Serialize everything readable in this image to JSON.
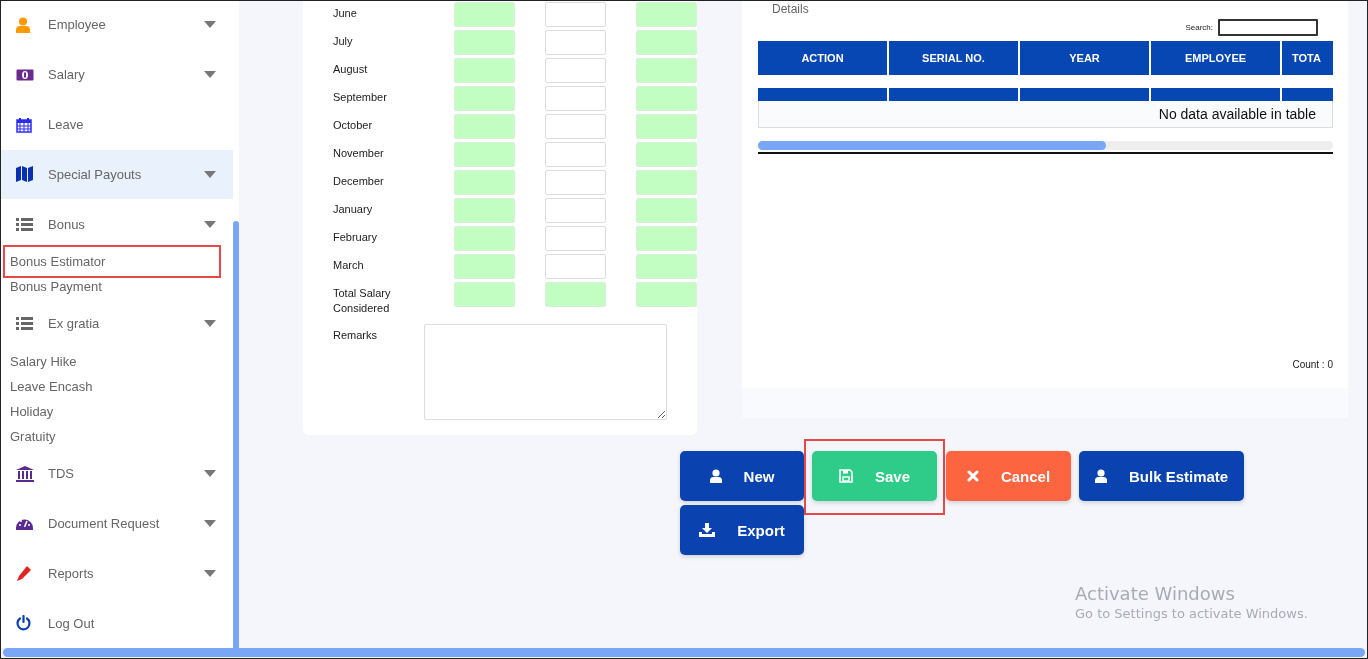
{
  "sidebar": {
    "items": [
      {
        "label": "Employee",
        "kind": "menu",
        "expandable": true,
        "selected": false
      },
      {
        "label": "Salary",
        "kind": "menu",
        "expandable": true,
        "selected": false
      },
      {
        "label": "Leave",
        "kind": "menu",
        "expandable": false,
        "selected": false
      },
      {
        "label": "Special Payouts",
        "kind": "menu",
        "expandable": true,
        "selected": true
      },
      {
        "label": "Bonus",
        "kind": "menu",
        "expandable": true,
        "selected": false
      },
      {
        "label": "Bonus Estimator",
        "kind": "sub",
        "highlighted": true
      },
      {
        "label": "Bonus Payment",
        "kind": "sub",
        "highlighted": false
      },
      {
        "label": "Ex gratia",
        "kind": "menu",
        "expandable": true,
        "selected": false
      },
      {
        "label": "Salary Hike",
        "kind": "sub",
        "highlighted": false
      },
      {
        "label": "Leave Encash",
        "kind": "sub",
        "highlighted": false
      },
      {
        "label": "Holiday",
        "kind": "sub",
        "highlighted": false
      },
      {
        "label": "Gratuity",
        "kind": "sub",
        "highlighted": false
      },
      {
        "label": "TDS",
        "kind": "menu",
        "expandable": true,
        "selected": false
      },
      {
        "label": "Document Request",
        "kind": "menu",
        "expandable": true,
        "selected": false
      },
      {
        "label": "Reports",
        "kind": "menu",
        "expandable": true,
        "selected": false
      },
      {
        "label": "Log Out",
        "kind": "menu",
        "expandable": false,
        "selected": false
      }
    ]
  },
  "salary_form": {
    "rows": [
      {
        "label": "June",
        "fields": [
          {
            "locked": true
          },
          {
            "locked": false
          },
          {
            "locked": true
          }
        ]
      },
      {
        "label": "July",
        "fields": [
          {
            "locked": true
          },
          {
            "locked": false
          },
          {
            "locked": true
          }
        ]
      },
      {
        "label": "August",
        "fields": [
          {
            "locked": true
          },
          {
            "locked": false
          },
          {
            "locked": true
          }
        ]
      },
      {
        "label": "September",
        "fields": [
          {
            "locked": true
          },
          {
            "locked": false
          },
          {
            "locked": true
          }
        ]
      },
      {
        "label": "October",
        "fields": [
          {
            "locked": true
          },
          {
            "locked": false
          },
          {
            "locked": true
          }
        ]
      },
      {
        "label": "November",
        "fields": [
          {
            "locked": true
          },
          {
            "locked": false
          },
          {
            "locked": true
          }
        ]
      },
      {
        "label": "December",
        "fields": [
          {
            "locked": true
          },
          {
            "locked": false
          },
          {
            "locked": true
          }
        ]
      },
      {
        "label": "January",
        "fields": [
          {
            "locked": true
          },
          {
            "locked": false
          },
          {
            "locked": true
          }
        ]
      },
      {
        "label": "February",
        "fields": [
          {
            "locked": true
          },
          {
            "locked": false
          },
          {
            "locked": true
          }
        ]
      },
      {
        "label": "March",
        "fields": [
          {
            "locked": true
          },
          {
            "locked": false
          },
          {
            "locked": true
          }
        ]
      },
      {
        "label": "Total Salary Considered",
        "fields": [
          {
            "locked": true
          },
          {
            "locked": true
          },
          {
            "locked": true
          }
        ]
      }
    ],
    "remarks_label": "Remarks"
  },
  "details": {
    "title": "Details",
    "search_label": "Search:",
    "columns": [
      "ACTION",
      "SERIAL NO.",
      "YEAR",
      "EMPLOYEE",
      "TOTA"
    ],
    "empty_message": "No data available in table",
    "count": "Count : 0"
  },
  "buttons": [
    {
      "label": "New",
      "kind": "primary",
      "highlighted": false
    },
    {
      "label": "Save",
      "kind": "success",
      "highlighted": true
    },
    {
      "label": "Cancel",
      "kind": "danger",
      "highlighted": false
    },
    {
      "label": "Bulk Estimate",
      "kind": "primary",
      "highlighted": false
    },
    {
      "label": "Export",
      "kind": "primary",
      "highlighted": false
    }
  ],
  "os_notice": {
    "title": "Activate Windows",
    "text": "Go to Settings to activate Windows."
  }
}
